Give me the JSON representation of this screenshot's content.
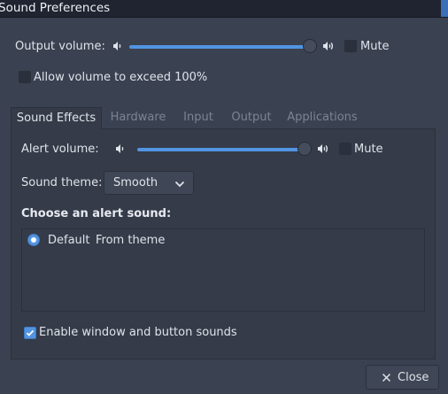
{
  "window": {
    "title": "Sound Preferences"
  },
  "output": {
    "label": "Output volume:",
    "volume_fraction": 1.0,
    "mute_label": "Mute",
    "mute_checked": false
  },
  "allow_exceed": {
    "label": "Allow volume to exceed 100%",
    "checked": false
  },
  "tabs": [
    {
      "label": "Sound Effects",
      "active": true
    },
    {
      "label": "Hardware",
      "active": false
    },
    {
      "label": "Input",
      "active": false
    },
    {
      "label": "Output",
      "active": false
    },
    {
      "label": "Applications",
      "active": false
    }
  ],
  "sound_effects": {
    "alert_label": "Alert volume:",
    "alert_volume_fraction": 1.0,
    "mute_label": "Mute",
    "mute_checked": false,
    "theme_label": "Sound theme:",
    "theme_value": "Smooth",
    "choose_heading": "Choose an alert sound:",
    "alerts": [
      {
        "name": "Default",
        "source": "From theme",
        "selected": true
      }
    ],
    "enable_sounds_label": "Enable window and button sounds",
    "enable_sounds_checked": true
  },
  "close_button": {
    "label": "Close"
  },
  "colors": {
    "accent": "#5294e2",
    "background": "#3a4150",
    "titlebar": "#1f2430"
  },
  "icons": {
    "volume_low": "speaker-low-icon",
    "volume_high": "speaker-high-icon",
    "close": "close-x-icon",
    "dropdown": "chevron-down-icon"
  }
}
